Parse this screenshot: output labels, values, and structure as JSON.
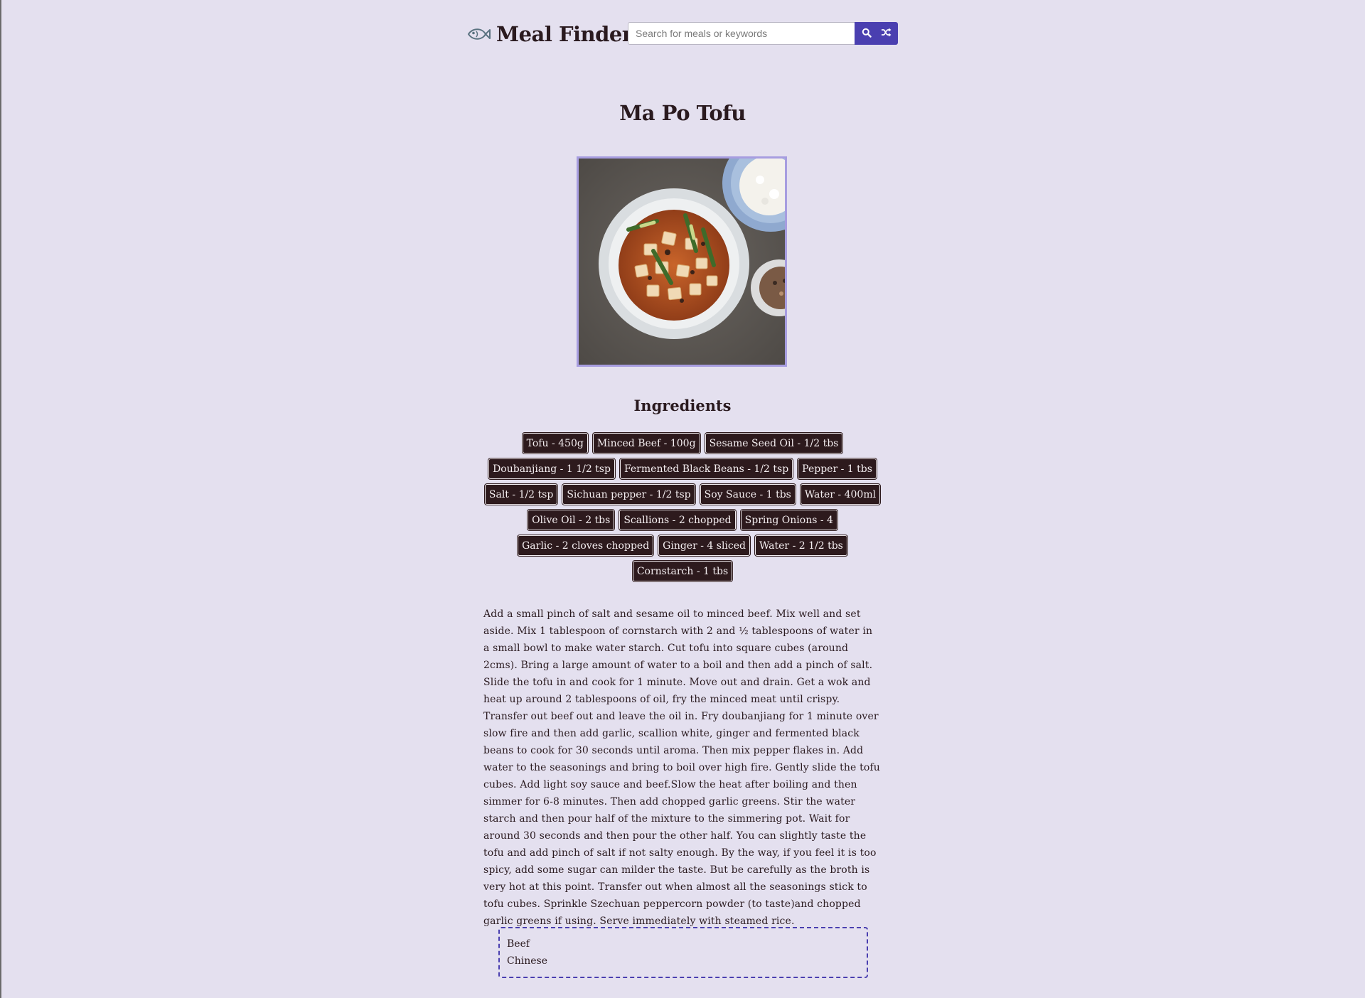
{
  "app": {
    "title": "Meal Finder"
  },
  "search": {
    "placeholder": "Search for meals or keywords",
    "value": ""
  },
  "meal": {
    "title": "Ma Po Tofu",
    "image_alt": "Ma Po Tofu",
    "ingredients_heading": "Ingredients",
    "ingredients": [
      "Tofu - 450g",
      "Minced Beef - 100g",
      "Sesame Seed Oil - 1/2 tbs",
      "Doubanjiang - 1 1/2 tsp",
      "Fermented Black Beans - 1/2 tsp",
      "Pepper - 1 tbs",
      "Salt - 1/2 tsp",
      "Sichuan pepper - 1/2 tsp",
      "Soy Sauce - 1 tbs",
      "Water - 400ml",
      "Olive Oil - 2 tbs",
      "Scallions - 2 chopped",
      "Spring Onions - 4",
      "Garlic - 2 cloves chopped",
      "Ginger - 4 sliced",
      "Water - 2 1/2 tbs",
      "Cornstarch - 1 tbs"
    ],
    "instructions": "Add a small pinch of salt and sesame oil to minced beef. Mix well and set aside. Mix 1 tablespoon of cornstarch with 2 and ½ tablespoons of water in a small bowl to make water starch. Cut tofu into square cubes (around 2cms). Bring a large amount of water to a boil and then add a pinch of salt. Slide the tofu in and cook for 1 minute. Move out and drain. Get a wok and heat up around 2 tablespoons of oil, fry the minced meat until crispy. Transfer out beef out and leave the oil in. Fry doubanjiang for 1 minute over slow fire and then add garlic, scallion white, ginger and fermented black beans to cook for 30 seconds until aroma. Then mix pepper flakes in. Add water to the seasonings and bring to boil over high fire. Gently slide the tofu cubes. Add light soy sauce and beef.Slow the heat after boiling and then simmer for 6-8 minutes. Then add chopped garlic greens. Stir the water starch and then pour half of the mixture to the simmering pot. Wait for around 30 seconds and then pour the other half. You can slightly taste the tofu and add pinch of salt if not salty enough. By the way, if you feel it is too spicy, add some sugar can milder the taste. But be carefully as the broth is very hot at this point. Transfer out when almost all the seasonings stick to tofu cubes. Sprinkle Szechuan peppercorn powder (to taste)and chopped garlic greens if using. Serve immediately with steamed rice.",
    "category": "Beef",
    "area": "Chinese"
  },
  "icons": {
    "logo": "fish-icon",
    "search": "search-icon",
    "random": "shuffle-icon"
  },
  "colors": {
    "background": "#e4e0ef",
    "accent": "#4a3fb0",
    "tag_bg": "#2d1a1d",
    "image_border": "#a79de0"
  }
}
